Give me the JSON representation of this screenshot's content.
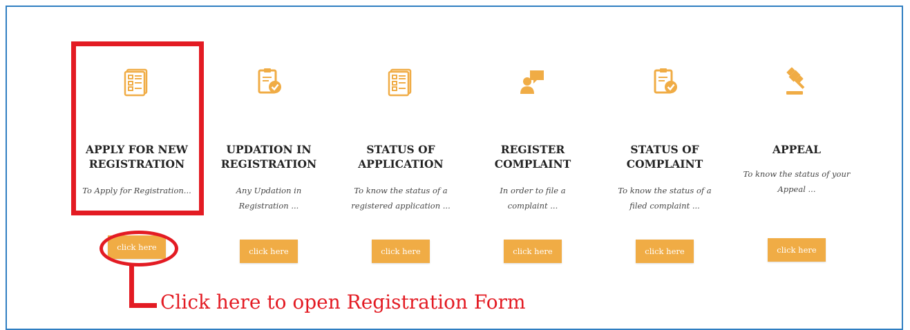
{
  "accent_color": "#f0ac45",
  "highlight_color": "#e31b23",
  "cards": [
    {
      "icon": "document-list-icon",
      "title": "APPLY FOR NEW\nREGISTRATION",
      "desc": "To Apply for Registration...",
      "button": "click here"
    },
    {
      "icon": "clipboard-check-icon",
      "title": "UPDATION IN\nREGISTRATION",
      "desc": "Any Updation in\nRegistration ...",
      "button": "click here"
    },
    {
      "icon": "document-list-icon",
      "title": "STATUS OF\nAPPLICATION",
      "desc": "To know the status of a\nregistered application ...",
      "button": "click here"
    },
    {
      "icon": "user-speech-bubble-icon",
      "title": "REGISTER\nCOMPLAINT",
      "desc": "In order to file a\ncomplaint ...",
      "button": "click here"
    },
    {
      "icon": "clipboard-check-icon",
      "title": "STATUS OF\nCOMPLAINT",
      "desc": "To know the status of a\nfiled complaint ...",
      "button": "click here"
    },
    {
      "icon": "gavel-icon",
      "title": "APPEAL",
      "desc": "To know the status of your\nAppeal ...",
      "button": "click here"
    }
  ],
  "annotation": {
    "callout_text": "Click here to open Registration Form"
  }
}
